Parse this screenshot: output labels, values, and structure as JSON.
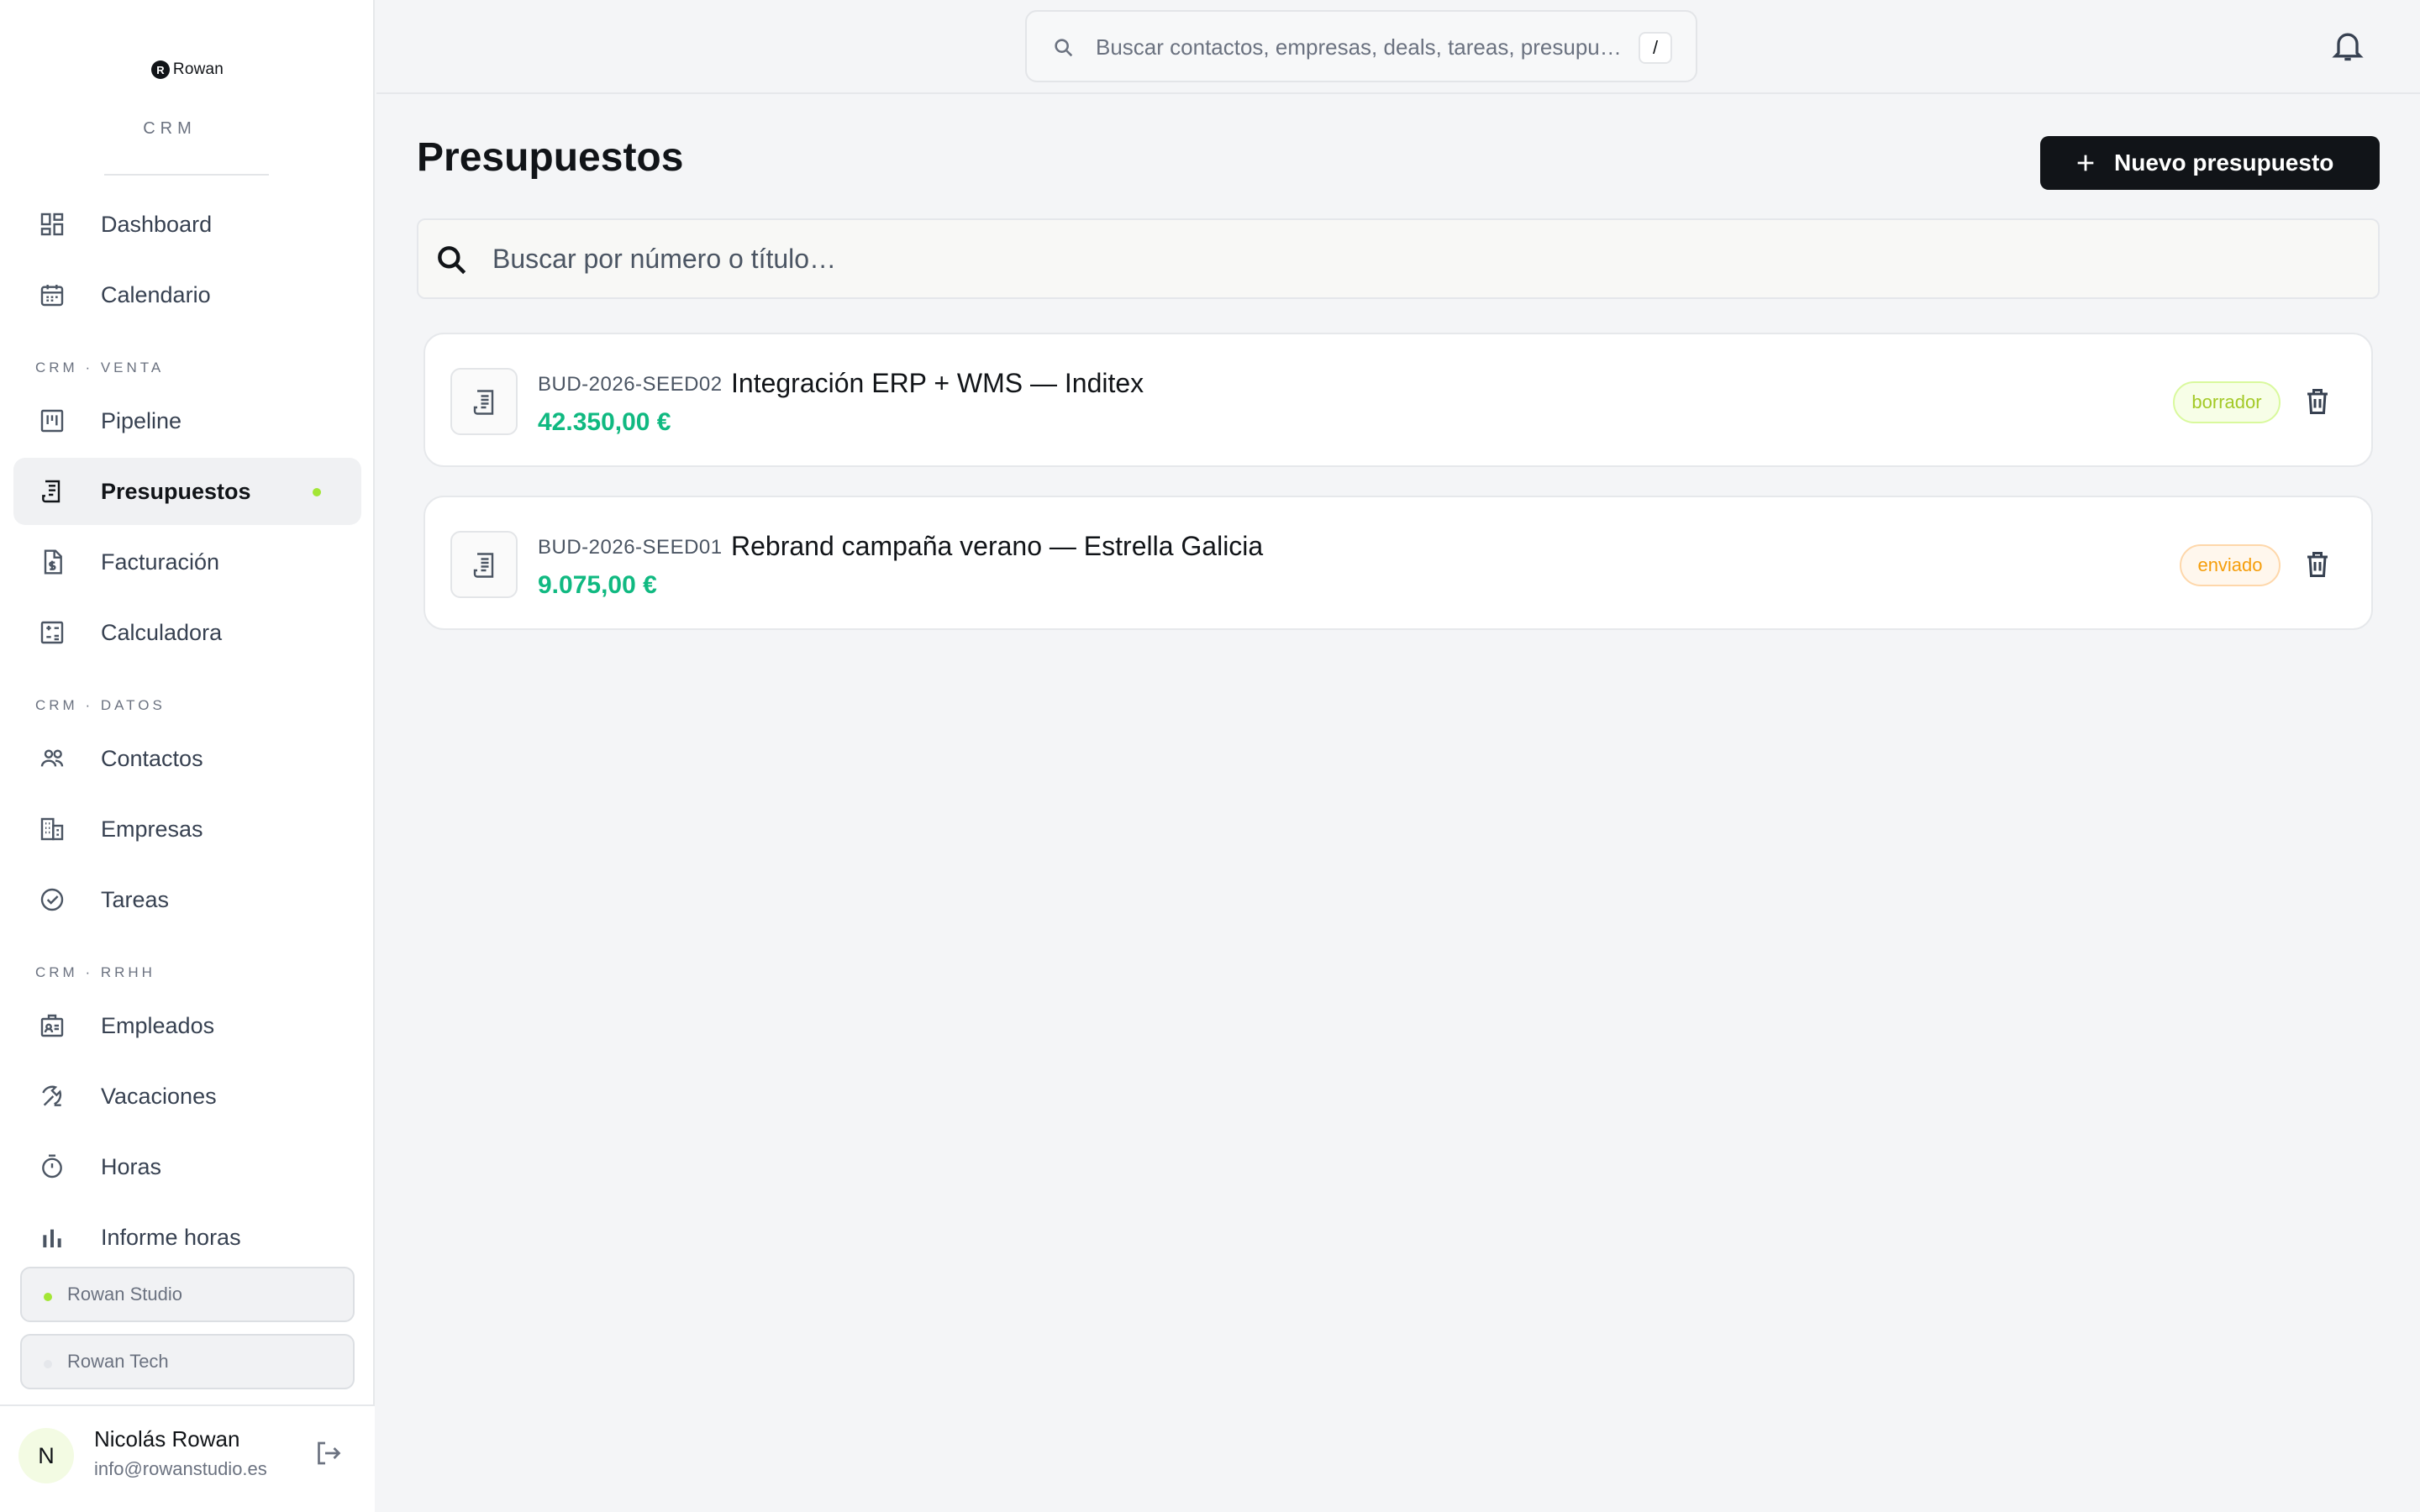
{
  "brand": {
    "name": "Rowan",
    "mark": "R",
    "sub": "CRM"
  },
  "sidebar": {
    "items": [
      {
        "label": "Dashboard",
        "icon": "dashboard-icon"
      },
      {
        "label": "Calendario",
        "icon": "calendar-icon"
      },
      {
        "section": "CRM · VENTA"
      },
      {
        "label": "Pipeline",
        "icon": "pipeline-icon"
      },
      {
        "label": "Presupuestos",
        "icon": "receipt-icon",
        "active": true
      },
      {
        "label": "Facturación",
        "icon": "invoice-icon"
      },
      {
        "label": "Calculadora",
        "icon": "calculator-icon"
      },
      {
        "section": "CRM · DATOS"
      },
      {
        "label": "Contactos",
        "icon": "people-icon"
      },
      {
        "label": "Empresas",
        "icon": "building-icon"
      },
      {
        "label": "Tareas",
        "icon": "check-circle-icon"
      },
      {
        "section": "CRM · RRHH"
      },
      {
        "label": "Empleados",
        "icon": "badge-icon"
      },
      {
        "label": "Vacaciones",
        "icon": "beach-icon"
      },
      {
        "label": "Horas",
        "icon": "timer-icon"
      },
      {
        "label": "Informe horas",
        "icon": "bar-chart-icon"
      }
    ],
    "sections": {
      "venta": "CRM · VENTA",
      "datos": "CRM · DATOS",
      "rrhh": "CRM · RRHH"
    },
    "labels": {
      "dashboard": "Dashboard",
      "calendario": "Calendario",
      "pipeline": "Pipeline",
      "presupuestos": "Presupuestos",
      "facturacion": "Facturación",
      "calculadora": "Calculadora",
      "contactos": "Contactos",
      "empresas": "Empresas",
      "tareas": "Tareas",
      "empleados": "Empleados",
      "vacaciones": "Vacaciones",
      "horas": "Horas",
      "informe_horas": "Informe horas"
    },
    "orgs": [
      {
        "name": "Rowan Studio",
        "dot_color": "#a3e635"
      },
      {
        "name": "Rowan Tech",
        "dot_color": "#e5e7eb"
      }
    ],
    "user": {
      "initial": "N",
      "name": "Nicolás Rowan",
      "email": "info@rowanstudio.es"
    }
  },
  "topbar": {
    "search_placeholder": "Buscar contactos, empresas, deals, tareas, presupu…",
    "shortcut": "/"
  },
  "main": {
    "title": "Presupuestos",
    "new_button": "Nuevo presupuesto",
    "search_placeholder": "Buscar por número o título…",
    "quotes": [
      {
        "number": "BUD-2026-SEED02",
        "title": "Integración ERP + WMS — Inditex",
        "amount": "42.350,00 €",
        "status": "borrador"
      },
      {
        "number": "BUD-2026-SEED01",
        "title": "Rebrand campaña verano — Estrella Galicia",
        "amount": "9.075,00 €",
        "status": "enviado"
      }
    ]
  },
  "colors": {
    "accent": "#111418",
    "active_dot": "#a3e635",
    "amount": "#10b981",
    "draft": "#a3c926",
    "sent": "#f59e0b"
  }
}
